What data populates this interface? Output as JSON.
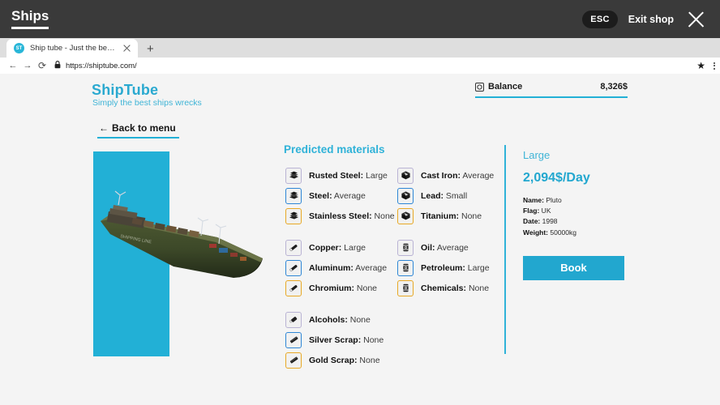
{
  "game_hud": {
    "tab_label": "Ships",
    "esc_key": "ESC",
    "exit_label": "Exit shop",
    "close_icon": "close-icon"
  },
  "browser": {
    "tab": {
      "favicon_text": "ST",
      "title": "Ship tube - Just the best ship...",
      "close_icon": "close-icon"
    },
    "new_tab_icon": "+",
    "back_icon": "←",
    "forward_icon": "→",
    "reload_icon": "⟳",
    "lock_icon": "🔒",
    "url": "https://shiptube.com/",
    "star_icon": "★"
  },
  "site": {
    "brand": "ShipTube",
    "tagline": "Simply the best ships wrecks",
    "back_to_menu": "Back to menu",
    "back_arrow": "←",
    "balance_label": "Balance",
    "balance_value": "8,326$",
    "coin_icon_glyph": "¤"
  },
  "materials": {
    "heading": "Predicted materials",
    "column1": [
      {
        "name": "Rusted Steel",
        "amount": "Large",
        "tier": "purple",
        "icon": "steel-plates-icon",
        "group": 1
      },
      {
        "name": "Steel",
        "amount": "Average",
        "tier": "blue",
        "icon": "steel-plates-icon",
        "group": 1
      },
      {
        "name": "Stainless Steel",
        "amount": "None",
        "tier": "gold",
        "icon": "steel-plates-icon",
        "group": 1
      },
      {
        "name": "Copper",
        "amount": "Large",
        "tier": "purple",
        "icon": "metal-rod-icon",
        "group": 2
      },
      {
        "name": "Aluminum",
        "amount": "Average",
        "tier": "blue",
        "icon": "metal-rod-icon",
        "group": 2
      },
      {
        "name": "Chromium",
        "amount": "None",
        "tier": "gold",
        "icon": "metal-rod-icon",
        "group": 2
      },
      {
        "name": "Alcohols",
        "amount": "None",
        "tier": "purple",
        "icon": "bottle-icon",
        "group": 3
      },
      {
        "name": "Silver Scrap",
        "amount": "None",
        "tier": "blue",
        "icon": "scrap-bar-icon",
        "group": 3
      },
      {
        "name": "Gold Scrap",
        "amount": "None",
        "tier": "gold",
        "icon": "scrap-bar-icon",
        "group": 3
      }
    ],
    "column2": [
      {
        "name": "Cast Iron",
        "amount": "Average",
        "tier": "purple",
        "icon": "metal-cube-icon",
        "group": 1
      },
      {
        "name": "Lead",
        "amount": "Small",
        "tier": "blue",
        "icon": "metal-cube-icon",
        "group": 1
      },
      {
        "name": "Titanium",
        "amount": "None",
        "tier": "gold",
        "icon": "metal-cube-icon",
        "group": 1
      },
      {
        "name": "Oil",
        "amount": "Average",
        "tier": "purple",
        "icon": "barrel-icon",
        "group": 2
      },
      {
        "name": "Petroleum",
        "amount": "Large",
        "tier": "blue",
        "icon": "barrel-icon",
        "group": 2
      },
      {
        "name": "Chemicals",
        "amount": "None",
        "tier": "gold",
        "icon": "barrel-icon",
        "group": 2
      }
    ]
  },
  "detail": {
    "size": "Large",
    "price": "2,094$/Day",
    "specs": [
      {
        "label": "Name:",
        "value": "Pluto"
      },
      {
        "label": "Flag:",
        "value": "UK"
      },
      {
        "label": "Date:",
        "value": "1998"
      },
      {
        "label": "Weight:",
        "value": "50000kg"
      }
    ],
    "book_label": "Book"
  },
  "colors": {
    "accent": "#22b0d6",
    "hud_bar": "#3a3a3a",
    "page_bg": "#f4f4f4",
    "tier_purple": "#b9b3d4",
    "tier_blue": "#2e86d6",
    "tier_gold": "#e8a825"
  }
}
